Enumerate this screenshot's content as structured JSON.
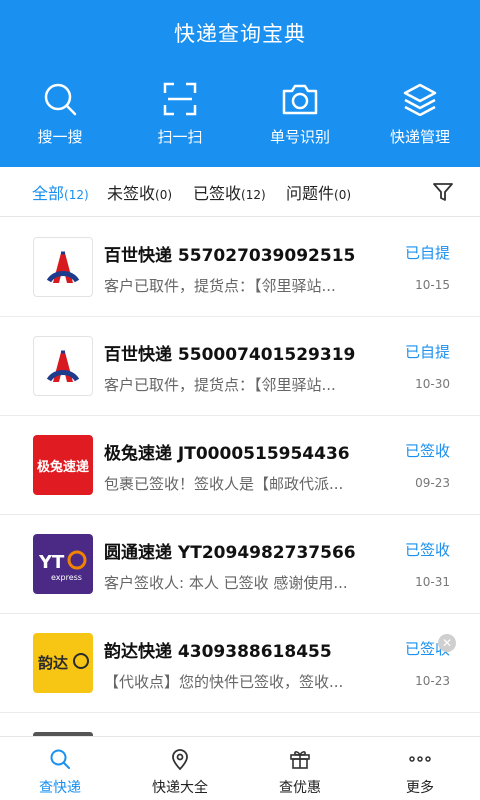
{
  "header": {
    "title": "快递查询宝典",
    "actions": [
      {
        "label": "搜一搜",
        "icon": "search-icon"
      },
      {
        "label": "扫一扫",
        "icon": "scan-icon"
      },
      {
        "label": "单号识别",
        "icon": "camera-icon"
      },
      {
        "label": "快递管理",
        "icon": "layers-icon"
      }
    ]
  },
  "tabs": [
    {
      "label": "全部",
      "count": "(12)",
      "active": true
    },
    {
      "label": "未签收",
      "count": "(0)",
      "active": false
    },
    {
      "label": "已签收",
      "count": "(12)",
      "active": false
    },
    {
      "label": "问题件",
      "count": "(0)",
      "active": false
    }
  ],
  "packages": [
    {
      "company": "百世快递",
      "number": "557027039092515",
      "desc": "客户已取件，提货点：【邻里驿站...",
      "status": "已自提",
      "date": "10-15",
      "logo": "百世"
    },
    {
      "company": "百世快递",
      "number": "550007401529319",
      "desc": "客户已取件，提货点：【邻里驿站...",
      "status": "已自提",
      "date": "10-30",
      "logo": "百世"
    },
    {
      "company": "极兔速递",
      "number": "JT0000515954436",
      "desc": "包裹已签收！签收人是【邮政代派...",
      "status": "已签收",
      "date": "09-23",
      "logo": "极兔速递"
    },
    {
      "company": "圆通速递",
      "number": "YT2094982737566",
      "desc": "客户签收人: 本人 已签收 感谢使用...",
      "status": "已签收",
      "date": "10-31",
      "logo": "YTO express"
    },
    {
      "company": "韵达快递",
      "number": "4309388618455",
      "desc": "【代收点】您的快件已签收，签收...",
      "status": "已签收",
      "date": "10-23",
      "logo": "韵达"
    }
  ],
  "bottom_nav": [
    {
      "label": "查快递",
      "icon": "search-icon",
      "active": true
    },
    {
      "label": "快递大全",
      "icon": "location-pin-icon",
      "active": false
    },
    {
      "label": "查优惠",
      "icon": "gift-icon",
      "active": false
    },
    {
      "label": "更多",
      "icon": "more-dots-icon",
      "active": false
    }
  ],
  "colors": {
    "accent": "#1a90f0",
    "jt_red": "#e01c22",
    "yt_purple": "#4b2a86",
    "yd_yellow": "#f7c514"
  }
}
